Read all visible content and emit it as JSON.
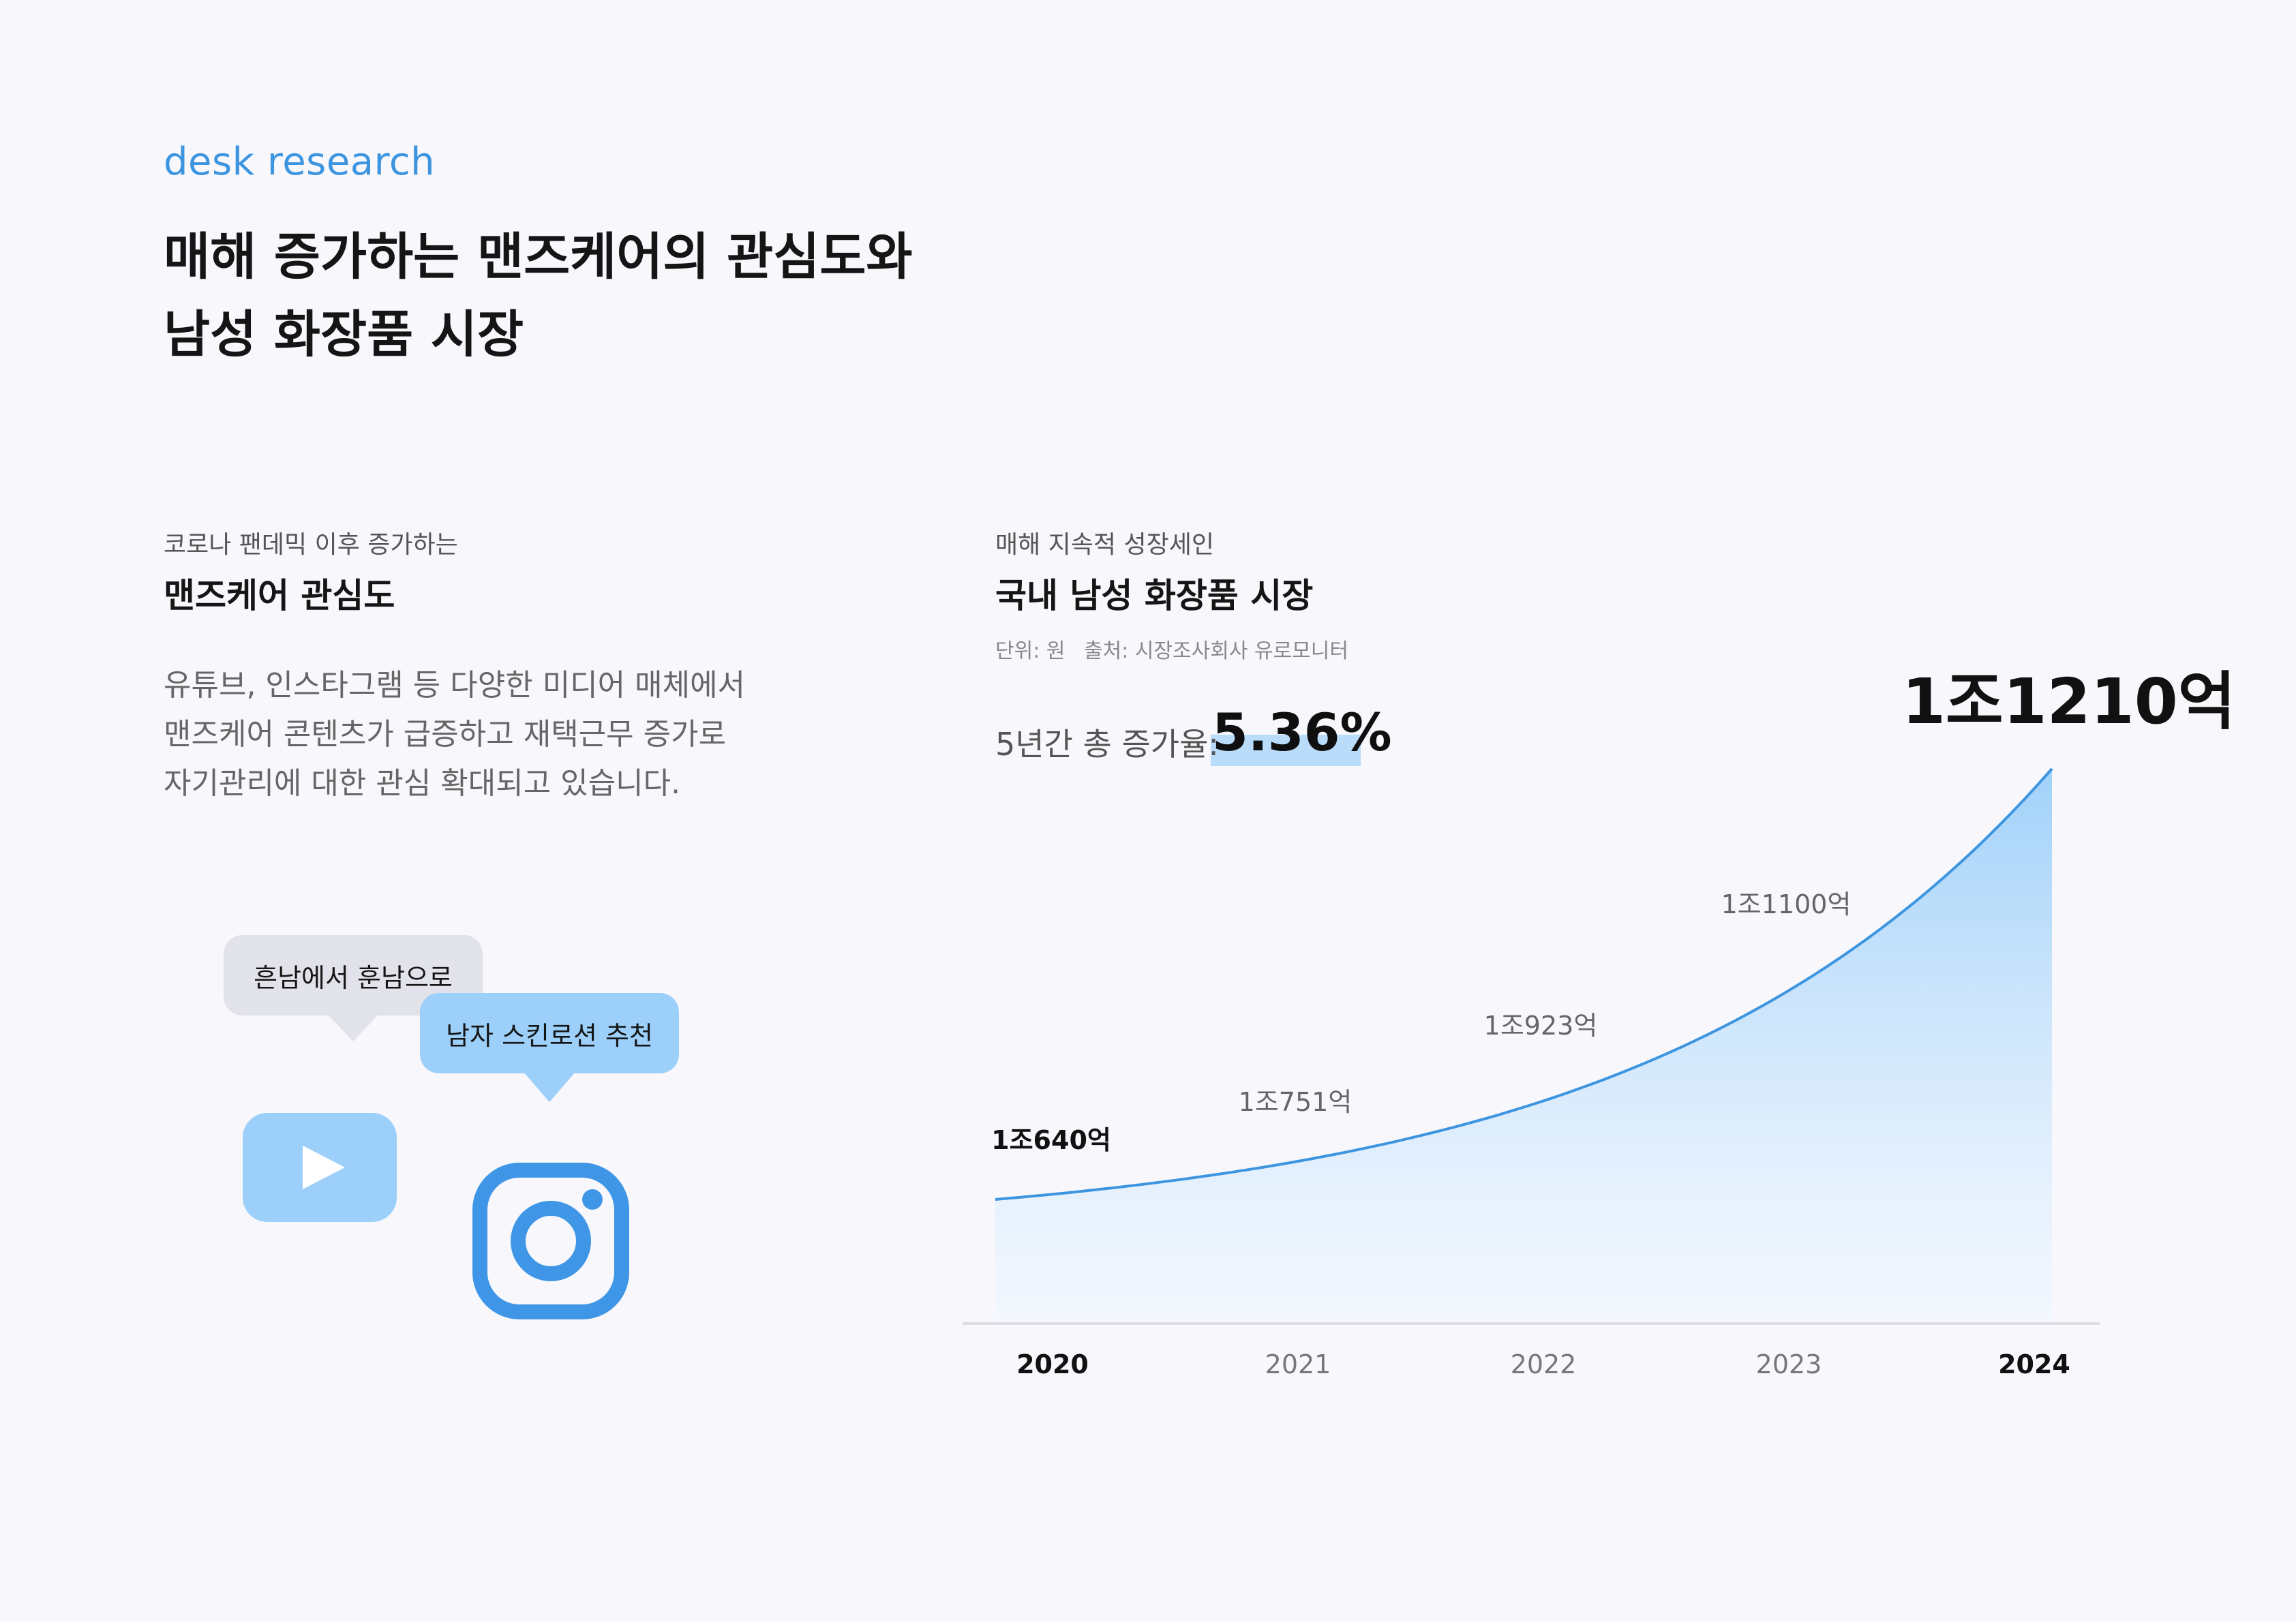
{
  "header": {
    "eyebrow": "desk research",
    "title_line1": "매해 증가하는 맨즈케어의 관심도와",
    "title_line2": "남성 화장품 시장"
  },
  "left": {
    "sub_label": "코로나 팬데믹 이후 증가하는",
    "sub_title": "맨즈케어 관심도",
    "body": [
      "유튜브, 인스타그램 등 다양한 미디어 매체에서",
      "맨즈케어 콘텐츠가 급증하고 재택근무 증가로",
      "자기관리에 대한 관심 확대되고 있습니다."
    ],
    "bubbles": {
      "youtube": "흔남에서 훈남으로",
      "instagram": "남자 스킨로션 추천"
    },
    "icons": [
      "youtube-icon",
      "instagram-icon"
    ],
    "colors": {
      "icon_light": "#9ccff9",
      "icon_dark": "#3f96e6"
    }
  },
  "right": {
    "sub_label": "매해 지속적 성장세인",
    "sub_title": "국내 남성 화장품 시장",
    "unit": "단위: 원",
    "source": "출처: 시장조사회사 유로모니터",
    "growth_label": "5년간 총 증가율:",
    "growth_value": "5.36%"
  },
  "chart_data": {
    "type": "area",
    "x": [
      "2020",
      "2021",
      "2022",
      "2023",
      "2024"
    ],
    "series": [
      {
        "values": [
          10640,
          10751,
          10923,
          11100,
          11210
        ]
      }
    ],
    "data_labels": [
      "1조640억",
      "1조751억",
      "1조923억",
      "1조1100억",
      "1조1210억"
    ],
    "value_unit": "억 원",
    "highlight_categories": [
      "2020",
      "2024"
    ],
    "colors": {
      "line": "#3d95e0",
      "fill_top": "#9ccff9",
      "fill_bottom": "#f2f8ff",
      "axis": "#dcdde5"
    },
    "grid": false,
    "legend": "none"
  }
}
